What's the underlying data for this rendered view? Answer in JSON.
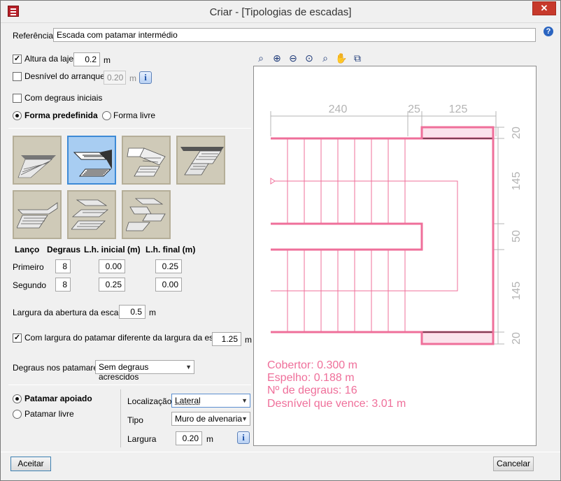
{
  "window": {
    "title": "Criar - [Tipologias de escadas]",
    "close_glyph": "✕",
    "help_glyph": "?"
  },
  "referencia": {
    "label": "Referência",
    "value": "Escada com patamar intermédio"
  },
  "altura_laje": {
    "label": "Altura da laje",
    "checked": true,
    "value": "0.2",
    "unit": "m"
  },
  "desnivel_arranque": {
    "label": "Desnível do arranque",
    "checked": false,
    "value": "0.20",
    "unit": "m",
    "info": "i"
  },
  "degraus_iniciais": {
    "label": "Com degraus iniciais",
    "checked": false
  },
  "forma": {
    "predefinida": "Forma predefinida",
    "livre": "Forma livre",
    "selected": "predefinida"
  },
  "thumbnails": [
    {
      "name": "straight-flight",
      "selected": false
    },
    {
      "name": "two-flights-landing",
      "selected": true
    },
    {
      "name": "three-flights",
      "selected": false
    },
    {
      "name": "l-shape-landing",
      "selected": false
    },
    {
      "name": "straight-with-landing",
      "selected": false
    },
    {
      "name": "triple-parallel",
      "selected": false
    },
    {
      "name": "spiral-landings",
      "selected": false
    }
  ],
  "flights_table": {
    "headers": [
      "Lanço",
      "Degraus",
      "L.h. inicial (m)",
      "L.h. final (m)"
    ],
    "rows": [
      {
        "name": "Primeiro",
        "degraus": "8",
        "inicial": "0.00",
        "final": "0.25"
      },
      {
        "name": "Segundo",
        "degraus": "8",
        "inicial": "0.25",
        "final": "0.00"
      }
    ]
  },
  "largura_abertura": {
    "label": "Largura da abertura da escada",
    "value": "0.5",
    "unit": "m"
  },
  "largura_patamar": {
    "label": "Com largura do patamar diferente da largura da escada",
    "checked": true,
    "value": "1.25",
    "unit": "m"
  },
  "degraus_patamares": {
    "label": "Degraus nos patamares",
    "value": "Sem degraus acrescidos"
  },
  "patamar": {
    "apoiado": "Patamar apoiado",
    "livre": "Patamar livre",
    "selected": "apoiado",
    "localizacao": {
      "label": "Localização",
      "value": "Lateral"
    },
    "tipo": {
      "label": "Tipo",
      "value": "Muro de alvenaria"
    },
    "largura": {
      "label": "Largura",
      "value": "0.20",
      "unit": "m",
      "info": "i"
    }
  },
  "toolbar_icons": [
    "zoom-region-icon",
    "zoom-window-icon",
    "zoom-out-icon",
    "zoom-extents-icon",
    "zoom-in-icon",
    "pan-icon",
    "redraw-icon"
  ],
  "drawing": {
    "dims_top": [
      "240",
      "25",
      "125"
    ],
    "dims_right": [
      "20",
      "145",
      "50",
      "145",
      "20"
    ],
    "info": [
      "Cobertor: 0.300 m",
      "Espelho: 0.188 m",
      "Nº de degraus: 16",
      "Desnível que vence: 3.01 m"
    ],
    "colors": {
      "stair": "#ef6f9a",
      "text": "#ef6f9a",
      "dim": "#b4b4b4",
      "landing_fill": "#fbe3ec"
    }
  },
  "buttons": {
    "accept": "Aceitar",
    "cancel": "Cancelar"
  }
}
